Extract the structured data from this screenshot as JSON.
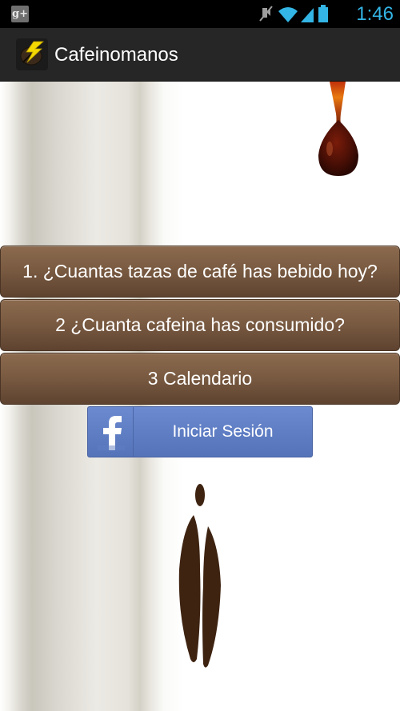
{
  "status_bar": {
    "time": "1:46",
    "icons": [
      "google-plus-icon",
      "mute-icon",
      "wifi-icon",
      "signal-icon",
      "battery-icon"
    ],
    "time_color": "#33b5e5"
  },
  "action_bar": {
    "title": "Cafeinomanos",
    "logo": "coffee-bolt-logo"
  },
  "menu": {
    "buttons": [
      {
        "label": "1. ¿Cuantas tazas de café has bebido hoy?"
      },
      {
        "label": "2 ¿Cuanta cafeina has consumido?"
      },
      {
        "label": "3 Calendario"
      }
    ],
    "button_color": "#7a5b42"
  },
  "facebook": {
    "label": "Iniciar Sesión",
    "icon": "facebook-icon",
    "color": "#5f7ec4"
  },
  "decorations": {
    "top_image": "coffee-drop",
    "bottom_image": "coffee-bean"
  }
}
